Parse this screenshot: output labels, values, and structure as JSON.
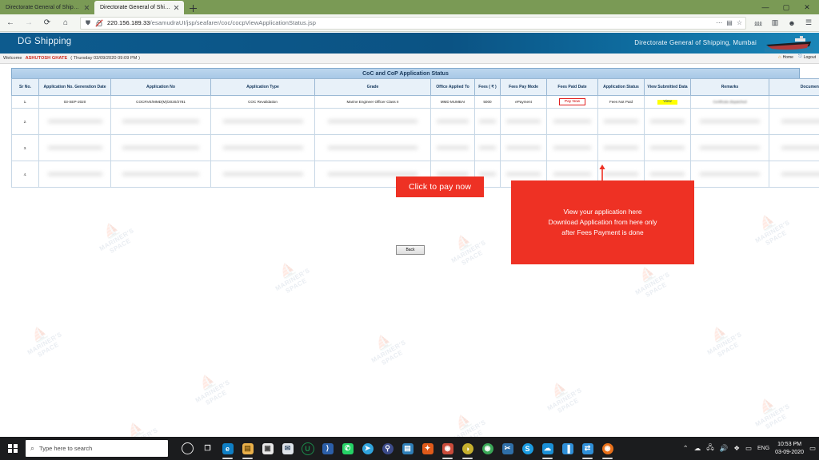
{
  "browser": {
    "tabs": [
      {
        "title": "Directorate General of Shipping : G...",
        "active": false
      },
      {
        "title": "Directorate General of Shipping",
        "active": true
      }
    ],
    "newtab_label": "+",
    "window_controls": {
      "minimize": "—",
      "maximize": "▢",
      "close": "✕"
    },
    "nav": {
      "back": "←",
      "forward": "→",
      "reload": "⟳",
      "home": "⌂"
    },
    "url": {
      "host": "220.156.189.33",
      "path": "/esamudraUI/jsp/seafarer/coc/cocpViewApplicationStatus.jsp",
      "full": "220.156.189.33/esamudraUI/jsp/seafarer/coc/cocpViewApplicationStatus.jsp"
    },
    "url_icons": {
      "shield": "⛊",
      "insecure": "🔓",
      "more": "⋯",
      "reader": "▤",
      "bookmark": "☆"
    },
    "toolbar_icons": {
      "library": "⅏",
      "sidebar": "▥",
      "account": "☻",
      "menu": "☰"
    }
  },
  "site": {
    "title": "DG Shipping",
    "org": "Directorate General of Shipping, Mumbai",
    "welcome_prefix": "Welcome",
    "welcome_user": "ASHUTOSH GHATE",
    "welcome_date": "( Thursday 03/09/2020 09:09 PM )",
    "links": [
      {
        "label": "Home",
        "icon": "home-icon"
      },
      {
        "label": "Logout",
        "icon": "logout-icon"
      }
    ]
  },
  "table": {
    "caption": "CoC and CoP  Application Status",
    "headers": [
      "Sr No.",
      "Application No. Generation Date",
      "Application No",
      "Application Type",
      "Grade",
      "Office Applied To",
      "Fees ( ₹ )",
      "Fees Pay Mode",
      "Fees Paid Date",
      "Application Status",
      "View Submitted Data",
      "Remarks",
      "Document Upload Status"
    ],
    "rows": [
      {
        "sr_no": "1.",
        "gen_date": "03-SEP-2020",
        "application_no": "COCRVE/MMD(M)/2020/2781",
        "application_type": "COC Revalidation",
        "grade": "Marine Engineer Officer Class II",
        "office": "MMD MUMBAI",
        "fees": "5000",
        "fees_mode": "ePayment",
        "fees_paid_date": "Pay Now",
        "status": "Fees Not Paid",
        "view": "View",
        "remarks": "Certificate dispatched",
        "doc_status": "",
        "blurred": false
      },
      {
        "sr_no": "2.",
        "blurred": true
      },
      {
        "sr_no": "3.",
        "blurred": true
      },
      {
        "sr_no": "4.",
        "blurred": true
      }
    ],
    "back_label": "Back"
  },
  "callouts": {
    "pay": "Click to pay now",
    "view_lines": [
      "View your application here",
      "Download Application from here only",
      "after Fees Payment is done"
    ],
    "accent_color": "#ee3124"
  },
  "watermark": {
    "line1": "MARINER'S",
    "line2": "SPACE"
  },
  "taskbar": {
    "search_placeholder": "Type here to search",
    "icons": [
      {
        "name": "cortana-icon",
        "glyph": "◯",
        "color": "transparent",
        "running": false
      },
      {
        "name": "task-view-icon",
        "glyph": "❐",
        "color": "transparent",
        "running": false
      },
      {
        "name": "edge-icon",
        "glyph": "e",
        "color": "#0f7fc4",
        "running": true
      },
      {
        "name": "file-explorer-icon",
        "glyph": "📁",
        "color": "#e9b04a",
        "running": true
      },
      {
        "name": "microsoft-store-icon",
        "glyph": "▣",
        "color": "#e8e8e8",
        "running": false
      },
      {
        "name": "mail-icon",
        "glyph": "✉",
        "color": "#dfe4ea",
        "running": false
      },
      {
        "name": "utorrent-icon",
        "glyph": "U",
        "color": "#1a6b3c",
        "running": false
      },
      {
        "name": "powershell-icon",
        "glyph": "⟩",
        "color": "#2c5fa8",
        "running": false
      },
      {
        "name": "whatsapp-icon",
        "glyph": "✆",
        "color": "#25d366",
        "running": false
      },
      {
        "name": "telegram-icon",
        "glyph": "➤",
        "color": "#30a3dc",
        "running": false
      },
      {
        "name": "lock-app-icon",
        "glyph": "🔒",
        "color": "#3c4b8a",
        "running": false
      },
      {
        "name": "app-icon-1",
        "glyph": "▤",
        "color": "#2f7fb8",
        "running": false
      },
      {
        "name": "app-icon-2",
        "glyph": "✦",
        "color": "#2f7fb8",
        "running": false
      },
      {
        "name": "antivirus-icon",
        "glyph": "⬡",
        "color": "#e05a1a",
        "running": false
      },
      {
        "name": "app-icon-3",
        "glyph": "◉",
        "color": "#c94b3a",
        "running": true
      },
      {
        "name": "photos-icon",
        "glyph": "◑",
        "color": "#c6b02e",
        "running": true
      },
      {
        "name": "chrome-icon",
        "glyph": "◉",
        "color": "#3aa757",
        "running": false
      },
      {
        "name": "vscode-icon",
        "glyph": "✂",
        "color": "#2f6fa8",
        "running": false
      },
      {
        "name": "skype-icon",
        "glyph": "S",
        "color": "#1b9be0",
        "running": false
      },
      {
        "name": "onedrive-icon",
        "glyph": "☁",
        "color": "#1a8fd6",
        "running": true
      },
      {
        "name": "app-icon-4",
        "glyph": "▐",
        "color": "#2f8fd8",
        "running": false
      },
      {
        "name": "app-icon-5",
        "glyph": "⇄",
        "color": "#2f8fd8",
        "running": true
      },
      {
        "name": "firefox-icon",
        "glyph": "◉",
        "color": "#e8701a",
        "running": true
      }
    ],
    "tray": {
      "chevron": "⌃",
      "cloud": "☁",
      "network": "🖧",
      "volume": "🔊",
      "dropbox": "❖",
      "battery": "▭",
      "language": "ENG",
      "time": "10:53 PM",
      "date": "03-09-2020",
      "show_desktop": ""
    }
  }
}
